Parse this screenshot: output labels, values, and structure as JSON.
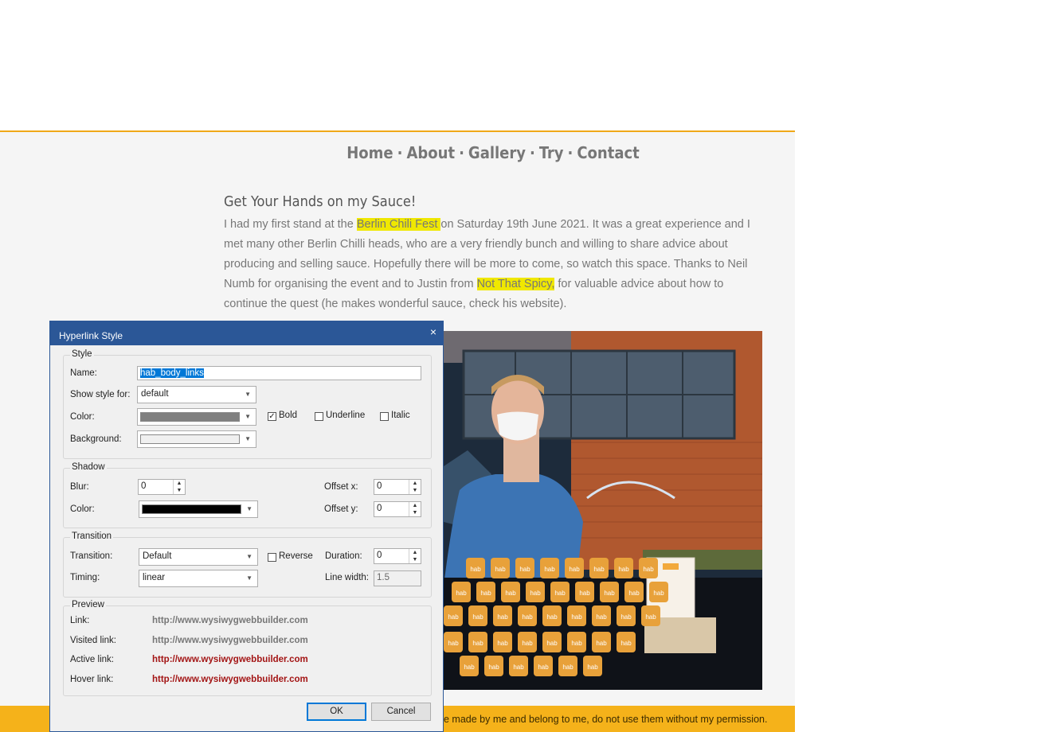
{
  "site": {
    "nav": [
      "Home",
      "About",
      "Gallery",
      "Try",
      "Contact"
    ],
    "separator": "·",
    "heading": "Get Your Hands on my Sauce!",
    "para": {
      "p1": "I had my first stand at the ",
      "link1": "Berlin Chili Fest ",
      "p2": "on Saturday 19th June 2021.  It was a great experience and I met many other Berlin Chilli heads, who are a very friendly bunch and willing to share advice about producing and selling sauce. Hopefully there will be more to come, so watch this space. Thanks to Neil Numb for organising the event and to Justin from ",
      "link2": "Not That Spicy,",
      "p3": " for valuable advice about how to continue the quest (he makes wonderful sauce, check his website)."
    },
    "jar_label": "hab",
    "footer": "e made by me and belong to me, do not use them without my permission."
  },
  "dialog": {
    "title": "Hyperlink Style",
    "close": "×",
    "style_group": "Style",
    "name_label": "Name:",
    "name_value": "hab_body_links",
    "show_style_label": "Show style for:",
    "show_style_value": "default",
    "color_label": "Color:",
    "bold_label": "Bold",
    "underline_label": "Underline",
    "italic_label": "Italic",
    "background_label": "Background:",
    "shadow_group": "Shadow",
    "blur_label": "Blur:",
    "blur_value": "0",
    "shadow_color_label": "Color:",
    "offset_x_label": "Offset x:",
    "offset_x_value": "0",
    "offset_y_label": "Offset y:",
    "offset_y_value": "0",
    "transition_group": "Transition",
    "transition_label": "Transition:",
    "transition_value": "Default",
    "reverse_label": "Reverse",
    "duration_label": "Duration:",
    "duration_value": "0",
    "timing_label": "Timing:",
    "timing_value": "linear",
    "line_width_label": "Line width:",
    "line_width_value": "1.5",
    "preview_group": "Preview",
    "link_label": "Link:",
    "visited_label": "Visited link:",
    "active_label": "Active link:",
    "hover_label": "Hover link:",
    "preview_url": "http://www.wysiwygwebbuilder.com",
    "ok": "OK",
    "cancel": "Cancel"
  },
  "colors": {
    "accent": "#f0a818",
    "highlight": "#f0e800",
    "dialog_title": "#2b5797",
    "link_normal": "#777777",
    "link_active": "#a31515"
  }
}
